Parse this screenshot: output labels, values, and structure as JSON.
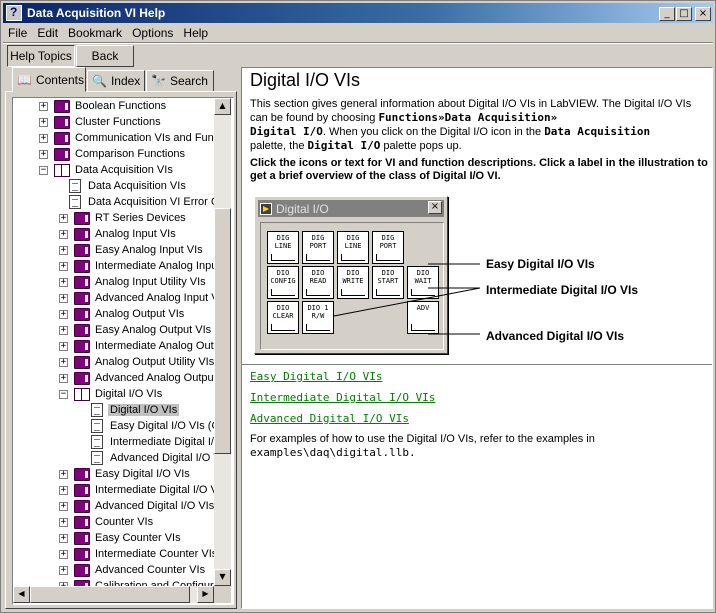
{
  "window": {
    "title": "Data Acquisition VI Help",
    "minimize": "_",
    "maximize": "□",
    "close": "×"
  },
  "menu": [
    "File",
    "Edit",
    "Bookmark",
    "Options",
    "Help"
  ],
  "toolbar": {
    "help_topics": "Help Topics",
    "back": "Back"
  },
  "tabs": [
    {
      "label": "Contents",
      "icon": "book-icon"
    },
    {
      "label": "Index",
      "icon": "key-icon"
    },
    {
      "label": "Search",
      "icon": "binoculars-icon"
    }
  ],
  "tree": [
    {
      "label": "Boolean Functions",
      "level": 0,
      "type": "book"
    },
    {
      "label": "Cluster Functions",
      "level": 0,
      "type": "book"
    },
    {
      "label": "Communication VIs and Functions",
      "level": 0,
      "type": "book"
    },
    {
      "label": "Comparison Functions",
      "level": 0,
      "type": "book"
    },
    {
      "label": "Data Acquisition VIs",
      "level": 0,
      "type": "open-book"
    },
    {
      "label": "Data Acquisition VIs",
      "level": 1,
      "type": "page"
    },
    {
      "label": "Data Acquisition VI Error Codes",
      "level": 1,
      "type": "page"
    },
    {
      "label": "RT Series Devices",
      "level": 1,
      "type": "book"
    },
    {
      "label": "Analog Input VIs",
      "level": 1,
      "type": "book"
    },
    {
      "label": "Easy Analog Input VIs",
      "level": 1,
      "type": "book"
    },
    {
      "label": "Intermediate Analog Input VIs",
      "level": 1,
      "type": "book"
    },
    {
      "label": "Analog Input Utility VIs",
      "level": 1,
      "type": "book"
    },
    {
      "label": "Advanced Analog Input VIs",
      "level": 1,
      "type": "book"
    },
    {
      "label": "Analog Output VIs",
      "level": 1,
      "type": "book"
    },
    {
      "label": "Easy Analog Output VIs",
      "level": 1,
      "type": "book"
    },
    {
      "label": "Intermediate Analog Output VIs",
      "level": 1,
      "type": "book"
    },
    {
      "label": "Analog Output Utility VIs",
      "level": 1,
      "type": "book"
    },
    {
      "label": "Advanced Analog Output VIs",
      "level": 1,
      "type": "book"
    },
    {
      "label": "Digital I/O VIs",
      "level": 1,
      "type": "open-book"
    },
    {
      "label": "Digital I/O VIs",
      "level": 2,
      "type": "page",
      "selected": true
    },
    {
      "label": "Easy Digital I/O VIs (Class)",
      "level": 2,
      "type": "page"
    },
    {
      "label": "Intermediate Digital I/O VIs (Class)",
      "level": 2,
      "type": "page"
    },
    {
      "label": "Advanced Digital I/O VIs (Class)",
      "level": 2,
      "type": "page"
    },
    {
      "label": "Easy Digital I/O VIs",
      "level": 1,
      "type": "book"
    },
    {
      "label": "Intermediate Digital I/O VIs",
      "level": 1,
      "type": "book"
    },
    {
      "label": "Advanced Digital I/O VIs",
      "level": 1,
      "type": "book"
    },
    {
      "label": "Counter VIs",
      "level": 1,
      "type": "book"
    },
    {
      "label": "Easy Counter VIs",
      "level": 1,
      "type": "book"
    },
    {
      "label": "Intermediate Counter VIs",
      "level": 1,
      "type": "book"
    },
    {
      "label": "Advanced Counter VIs",
      "level": 1,
      "type": "book"
    },
    {
      "label": "Calibration and Configuration VIs",
      "level": 1,
      "type": "book"
    }
  ],
  "content": {
    "heading": "Digital I/O VIs",
    "p1_a": "This section gives general information about Digital I/O VIs in LabVIEW. The Digital I/O VIs can be found by choosing ",
    "p1_b": "Functions»Data Acquisition»",
    "p1_c": "Digital I/O",
    "p1_d": ". When you click on the Digital I/O icon in the ",
    "p1_e": "Data Acquisition",
    "p1_f": " palette, the ",
    "p1_g": "Digital I/O",
    "p1_h": " palette pops up.",
    "p2": "Click the icons or text for VI and function descriptions. Click a label in the illustration to get a brief overview of the class of Digital I/O VI.",
    "palette_title": "Digital I/O",
    "callouts": [
      "Easy Digital I/O VIs",
      "Intermediate Digital I/O VIs",
      "Advanced Digital I/O VIs"
    ],
    "links": [
      "Easy Digital I/O VIs",
      "Intermediate Digital I/O VIs",
      "Advanced Digital I/O VIs"
    ],
    "p3_a": "For examples of how to use the Digital I/O VIs, refer to the examples in",
    "p3_b": "examples\\daq\\digital.llb."
  },
  "vi_icons": [
    {
      "line1": "DIG",
      "line2": "LINE"
    },
    {
      "line1": "DIG",
      "line2": "PORT"
    },
    {
      "line1": "DIG",
      "line2": "LINE"
    },
    {
      "line1": "DIG",
      "line2": "PORT"
    },
    {
      "line1": "DIO",
      "line2": "CONFIG"
    },
    {
      "line1": "DIO",
      "line2": "READ"
    },
    {
      "line1": "DIO",
      "line2": "WRITE"
    },
    {
      "line1": "DIO",
      "line2": "START"
    },
    {
      "line1": "DIO",
      "line2": "WAIT"
    },
    {
      "line1": "DIO",
      "line2": "CLEAR"
    },
    {
      "line1": "DIO 1",
      "line2": "R/W"
    },
    {
      "line1": "ADV",
      "line2": ""
    }
  ]
}
